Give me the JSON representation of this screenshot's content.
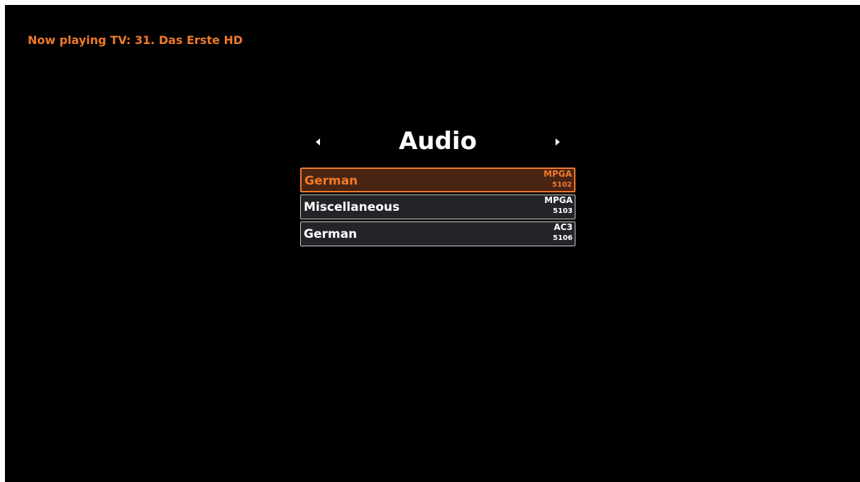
{
  "status": {
    "now_playing": "Now playing TV: 31. Das Erste HD"
  },
  "menu": {
    "title": "Audio",
    "prev_icon": "triangle-left-icon",
    "next_icon": "triangle-right-icon"
  },
  "tracks": [
    {
      "language": "German",
      "codec": "MPGA",
      "pid": "5102",
      "selected": true
    },
    {
      "language": "Miscellaneous",
      "codec": "MPGA",
      "pid": "5103",
      "selected": false
    },
    {
      "language": "German",
      "codec": "AC3",
      "pid": "5106",
      "selected": false
    }
  ],
  "colors": {
    "accent": "#f07a2a",
    "background": "#000000",
    "row_background": "#232428",
    "text": "#ffffff"
  }
}
